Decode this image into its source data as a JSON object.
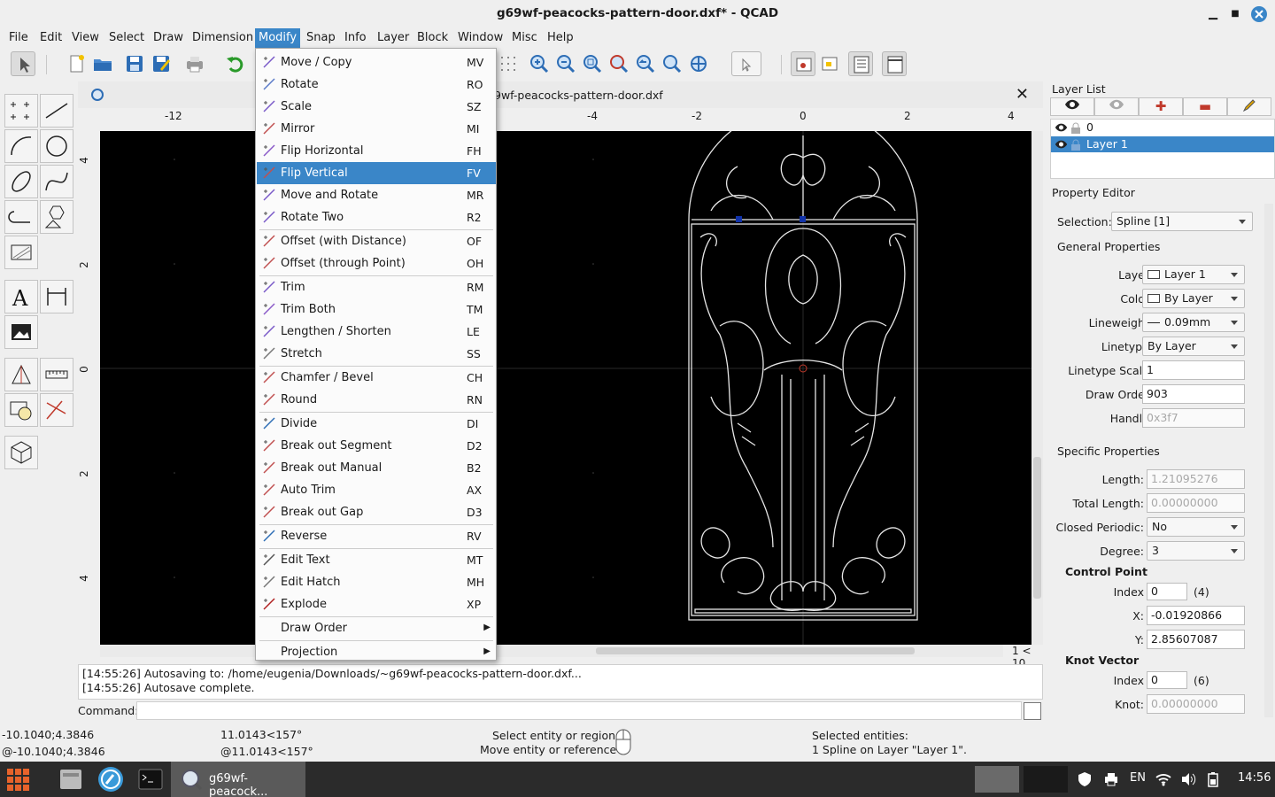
{
  "window": {
    "title": "g69wf-peacocks-pattern-door.dxf* - QCAD"
  },
  "menubar": [
    "File",
    "Edit",
    "View",
    "Select",
    "Draw",
    "Dimension",
    "Modify",
    "Snap",
    "Info",
    "Layer",
    "Block",
    "Window",
    "Misc",
    "Help"
  ],
  "document": {
    "tab_title": "9wf-peacocks-pattern-door.dxf",
    "hruler": [
      "-12",
      "-4",
      "-2",
      "0",
      "2",
      "4"
    ],
    "vruler": [
      "4",
      "2",
      "0",
      "2",
      "4"
    ],
    "zoom_label": "1 < 10"
  },
  "modify_menu": [
    {
      "label": "Move / Copy",
      "shortcut": "MV",
      "icon": "move-copy-icon"
    },
    {
      "label": "Rotate",
      "shortcut": "RO",
      "icon": "rotate-icon"
    },
    {
      "label": "Scale",
      "shortcut": "SZ",
      "icon": "scale-icon"
    },
    {
      "label": "Mirror",
      "shortcut": "MI",
      "icon": "mirror-icon"
    },
    {
      "label": "Flip Horizontal",
      "shortcut": "FH",
      "icon": "flip-horizontal-icon"
    },
    {
      "label": "Flip Vertical",
      "shortcut": "FV",
      "icon": "flip-vertical-icon",
      "highlighted": true
    },
    {
      "label": "Move and Rotate",
      "shortcut": "MR",
      "icon": "move-rotate-icon"
    },
    {
      "label": "Rotate Two",
      "shortcut": "R2",
      "icon": "rotate-two-icon"
    },
    {
      "label": "Offset (with Distance)",
      "shortcut": "OF",
      "icon": "offset-distance-icon"
    },
    {
      "label": "Offset (through Point)",
      "shortcut": "OH",
      "icon": "offset-point-icon"
    },
    {
      "label": "Trim",
      "shortcut": "RM",
      "icon": "trim-icon"
    },
    {
      "label": "Trim Both",
      "shortcut": "TM",
      "icon": "trim-both-icon"
    },
    {
      "label": "Lengthen / Shorten",
      "shortcut": "LE",
      "icon": "lengthen-icon"
    },
    {
      "label": "Stretch",
      "shortcut": "SS",
      "icon": "stretch-icon"
    },
    {
      "label": "Chamfer / Bevel",
      "shortcut": "CH",
      "icon": "chamfer-icon"
    },
    {
      "label": "Round",
      "shortcut": "RN",
      "icon": "round-icon"
    },
    {
      "label": "Divide",
      "shortcut": "DI",
      "icon": "divide-icon"
    },
    {
      "label": "Break out Segment",
      "shortcut": "D2",
      "icon": "break-segment-icon"
    },
    {
      "label": "Break out Manual",
      "shortcut": "B2",
      "icon": "break-manual-icon"
    },
    {
      "label": "Auto Trim",
      "shortcut": "AX",
      "icon": "auto-trim-icon"
    },
    {
      "label": "Break out Gap",
      "shortcut": "D3",
      "icon": "break-gap-icon"
    },
    {
      "label": "Reverse",
      "shortcut": "RV",
      "icon": "reverse-icon"
    },
    {
      "label": "Edit Text",
      "shortcut": "MT",
      "icon": "edit-text-icon"
    },
    {
      "label": "Edit Hatch",
      "shortcut": "MH",
      "icon": "edit-hatch-icon"
    },
    {
      "label": "Explode",
      "shortcut": "XP",
      "icon": "explode-icon"
    },
    {
      "label": "Draw Order",
      "shortcut": "",
      "icon": "",
      "submenu": true
    },
    {
      "label": "Projection",
      "shortcut": "",
      "icon": "",
      "submenu": true
    }
  ],
  "log": [
    "[14:55:26] Autosaving to: /home/eugenia/Downloads/~g69wf-peacocks-pattern-door.dxf...",
    "[14:55:26] Autosave complete."
  ],
  "command": {
    "label": "Command:"
  },
  "status": {
    "abs_coord": "-10.1040;4.3846",
    "rel_coord": "@-10.1040;4.3846",
    "polar": "11.0143<157°",
    "rel_polar": "@11.0143<157°",
    "mouse_left": "Select entity or region",
    "mouse_right": "Move entity or reference",
    "selected_title": "Selected entities:",
    "selected_desc": "1 Spline on Layer \"Layer 1\"."
  },
  "layer_list": {
    "title": "Layer List",
    "layers": [
      {
        "name": "0",
        "selected": false
      },
      {
        "name": "Layer 1",
        "selected": true
      }
    ]
  },
  "property_editor": {
    "title": "Property Editor",
    "selection_label": "Selection:",
    "selection_value": "Spline [1]",
    "general_title": "General Properties",
    "layer_label": "Layer:",
    "layer_value": "Layer 1",
    "color_label": "Color:",
    "color_value": "By Layer",
    "lineweight_label": "Lineweight:",
    "lineweight_value": "0.09mm",
    "linetype_label": "Linetype:",
    "linetype_value": "By Layer",
    "linetype_scale_label": "Linetype Scale:",
    "linetype_scale_value": "1",
    "draw_order_label": "Draw Order:",
    "draw_order_value": "903",
    "handle_label": "Handle:",
    "handle_value": "0x3f7",
    "specific_title": "Specific Properties",
    "length_label": "Length:",
    "length_value": "1.21095276",
    "total_length_label": "Total Length:",
    "total_length_value": "0.00000000",
    "closed_label": "Closed Periodic:",
    "closed_value": "No",
    "degree_label": "Degree:",
    "degree_value": "3",
    "cp_title": "Control Point",
    "cp_index_label": "Index",
    "cp_index_value": "0",
    "cp_count": "(4)",
    "cp_x_label": "X:",
    "cp_x_value": "-0.01920866",
    "cp_y_label": "Y:",
    "cp_y_value": "2.85607087",
    "kv_title": "Knot Vector",
    "kv_index_label": "Index",
    "kv_index_value": "0",
    "kv_count": "(6)",
    "knot_label": "Knot:",
    "knot_value": "0.00000000"
  },
  "taskbar": {
    "task_label": "g69wf-peacock...",
    "lang": "EN",
    "clock": "14:56"
  },
  "colors": {
    "accent": "#3a86c8",
    "canvas": "#000000",
    "taskbar": "#2b2b2b"
  }
}
